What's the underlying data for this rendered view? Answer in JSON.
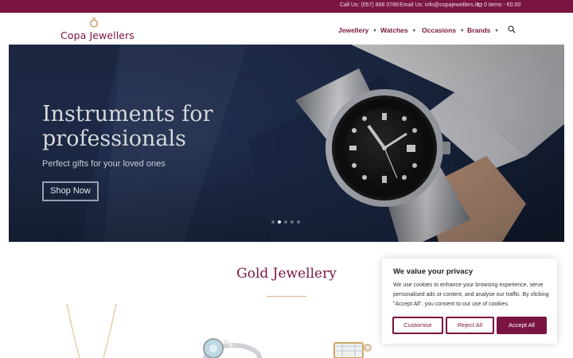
{
  "topbar": {
    "call": "Call Us: (057) 868 0789",
    "email": "Email Us: info@copajewellers.ie",
    "cart": "0 items - €0.00"
  },
  "brand": {
    "name": "Copa Jewellers"
  },
  "nav": {
    "items": [
      {
        "label": "Jewellery"
      },
      {
        "label": "Watches"
      },
      {
        "label": "Occasions"
      },
      {
        "label": "Brands"
      }
    ]
  },
  "hero": {
    "title": "Instruments for professionals",
    "subtitle": "Perfect gifts for your loved ones",
    "button": "Shop Now",
    "slides_total": 5,
    "active_slide": 2
  },
  "section": {
    "title": "Gold Jewellery"
  },
  "cookie": {
    "title": "We value your privacy",
    "text": "We use cookies to enhance your browsing experience, serve personalised ads or content, and analyse our traffic. By clicking \"Accept All\", you consent to our use of cookies.",
    "customise": "Customise",
    "reject": "Reject All",
    "accept": "Accept All"
  },
  "colors": {
    "brand": "#7a1541",
    "gold": "#d7b98a"
  }
}
